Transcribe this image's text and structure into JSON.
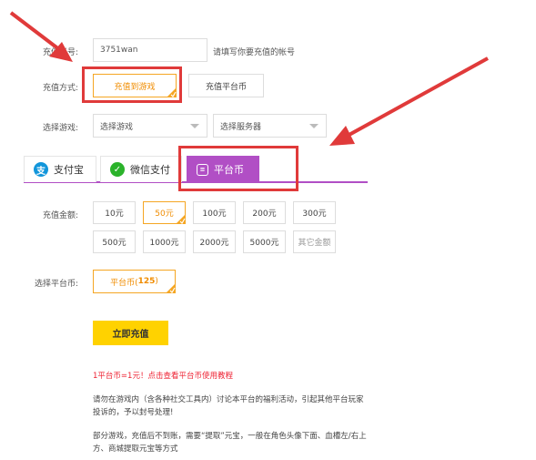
{
  "account": {
    "label": "充值账号:",
    "value": "3751wan",
    "hint": "请填写你要充值的帐号"
  },
  "method": {
    "label": "充值方式:",
    "options": [
      "充值到游戏",
      "充值平台币"
    ],
    "selected": 0
  },
  "game": {
    "label": "选择游戏:",
    "game_select": "选择游戏",
    "server_select": "选择服务器"
  },
  "tabs": [
    {
      "label": "支付宝",
      "icon": "alipay-icon",
      "color": "#1296db"
    },
    {
      "label": "微信支付",
      "icon": "wechat-icon",
      "color": "#2bb32b"
    },
    {
      "label": "平台币",
      "icon": "coin-stack-icon",
      "color": "#ffffff"
    }
  ],
  "active_tab": 2,
  "amount": {
    "label": "充值金额:",
    "row1": [
      "10元",
      "50元",
      "100元",
      "200元",
      "300元"
    ],
    "row2": [
      "500元",
      "1000元",
      "2000元",
      "5000元",
      "其它金额"
    ],
    "selected": "50元"
  },
  "platform_coin": {
    "label": "选择平台币:",
    "option_prefix": "平台币(",
    "option_count": "125",
    "option_suffix": ")"
  },
  "submit_label": "立即充值",
  "notes": {
    "rate": "1平台币=1元！点击查看平台币使用教程",
    "warning": "请勿在游戏内（含各种社交工具内）讨论本平台的福利活动，引起其他平台玩家投诉的，予以封号处理!",
    "tip": "部分游戏，充值后不到账，需要“提取”元宝，一般在角色头像下面、血槽左/右上方、商城提取元宝等方式"
  },
  "colors": {
    "accent_orange": "#f5a623",
    "tab_purple": "#b14fc5",
    "submit_yellow": "#ffd200",
    "annotation_red": "#e03a3a"
  }
}
